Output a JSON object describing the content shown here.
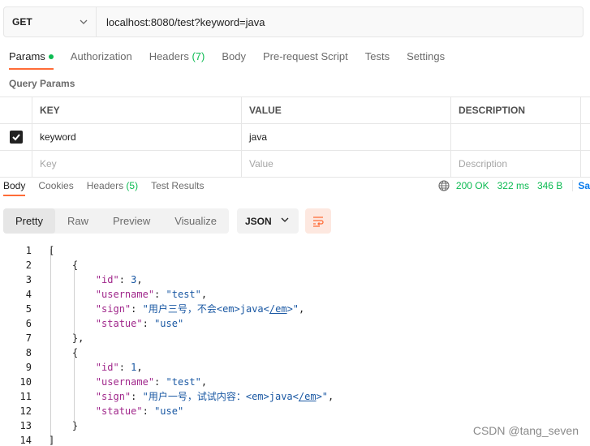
{
  "request": {
    "method": "GET",
    "url": "localhost:8080/test?keyword=java"
  },
  "request_tabs": [
    {
      "label": "Params",
      "active": true,
      "dot": true
    },
    {
      "label": "Authorization"
    },
    {
      "label": "Headers",
      "count": "(7)"
    },
    {
      "label": "Body"
    },
    {
      "label": "Pre-request Script"
    },
    {
      "label": "Tests"
    },
    {
      "label": "Settings"
    }
  ],
  "query_params": {
    "title": "Query Params",
    "columns": [
      "KEY",
      "VALUE",
      "DESCRIPTION"
    ],
    "rows": [
      {
        "checked": true,
        "key": "keyword",
        "value": "java",
        "description": ""
      }
    ],
    "placeholders": {
      "key": "Key",
      "value": "Value",
      "description": "Description"
    }
  },
  "response_tabs": [
    {
      "label": "Body",
      "active": true
    },
    {
      "label": "Cookies"
    },
    {
      "label": "Headers",
      "count": "(5)"
    },
    {
      "label": "Test Results"
    }
  ],
  "response_meta": {
    "status": "200 OK",
    "time": "322 ms",
    "size": "346 B",
    "save": "Sa"
  },
  "format_toolbar": {
    "modes": [
      "Pretty",
      "Raw",
      "Preview",
      "Visualize"
    ],
    "active_mode": "Pretty",
    "language": "JSON"
  },
  "code_lines": [
    {
      "n": "1",
      "t": "["
    },
    {
      "n": "2",
      "t": "    {"
    },
    {
      "n": "3",
      "t": "        \"id\": 3,"
    },
    {
      "n": "4",
      "t": "        \"username\": \"test\","
    },
    {
      "n": "5",
      "t": "        \"sign\": \"用户三号，不会<em>java</em>\","
    },
    {
      "n": "6",
      "t": "        \"statue\": \"use\""
    },
    {
      "n": "7",
      "t": "    },"
    },
    {
      "n": "8",
      "t": "    {"
    },
    {
      "n": "9",
      "t": "        \"id\": 1,"
    },
    {
      "n": "10",
      "t": "        \"username\": \"test\","
    },
    {
      "n": "11",
      "t": "        \"sign\": \"用户一号，试试内容：<em>java</em>\","
    },
    {
      "n": "12",
      "t": "        \"statue\": \"use\""
    },
    {
      "n": "13",
      "t": "    }"
    },
    {
      "n": "14",
      "t": "]"
    }
  ],
  "watermark": "CSDN @tang_seven",
  "colors": {
    "accent": "#ff6c37",
    "green": "#0cbb52",
    "key": "#a0278b",
    "string": "#1a58a3"
  }
}
